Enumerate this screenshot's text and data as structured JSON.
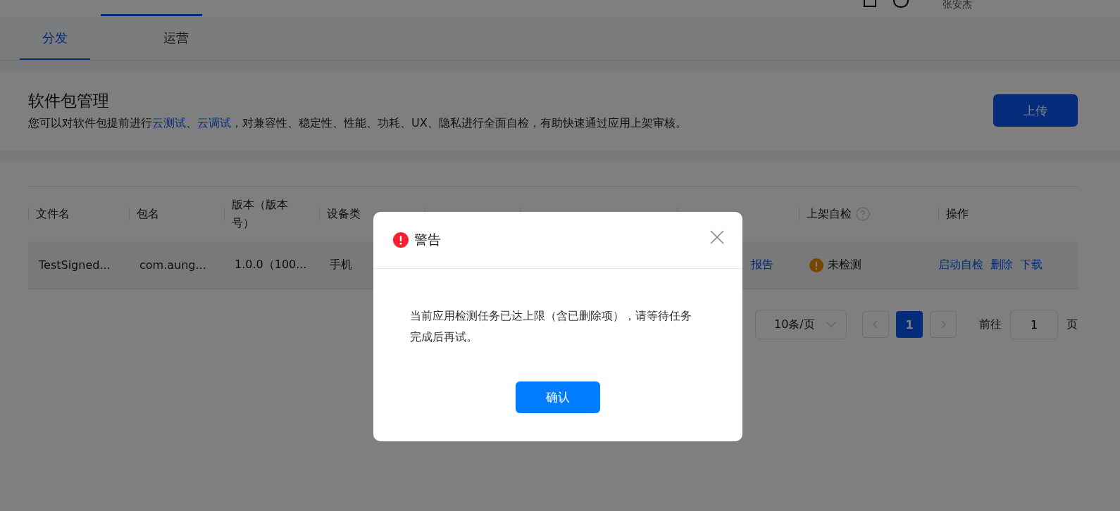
{
  "top_bar": {
    "user_name": "张安杰"
  },
  "tabs": [
    {
      "label": "分发",
      "selected": true
    },
    {
      "label": "运营",
      "selected": false
    }
  ],
  "header_card": {
    "title": "软件包管理",
    "description_parts": [
      {
        "text": "您可以对软件包提前进行",
        "link": false
      },
      {
        "text": "云测试",
        "link": true
      },
      {
        "text": "、",
        "link": false
      },
      {
        "text": "云调试",
        "link": true
      },
      {
        "text": "，对兼容性、稳定性、性能、功耗、UX、隐私进行全面自检，有助快速通过应用上架审核。",
        "link": false
      }
    ],
    "upload_button": "上传"
  },
  "table": {
    "columns": [
      {
        "label": "文件名",
        "help": false
      },
      {
        "label": "包名",
        "help": false
      },
      {
        "label": "版本（版本号）",
        "help": false
      },
      {
        "label": "设备类",
        "help": false
      },
      {
        "label": "上架自检",
        "help": true
      },
      {
        "label": "操作",
        "help": false
      }
    ],
    "rows": [
      {
        "file_name": "TestSigned...",
        "package": "com.aung...",
        "version": "1.0.0（100...",
        "device": "手机",
        "legality_link": "报告",
        "self_check": "未检测",
        "actions": [
          "启动自检",
          "删除",
          "下载"
        ]
      }
    ]
  },
  "pagination": {
    "page_size": "10条/页",
    "pages": [
      {
        "label": "1",
        "selected": true
      }
    ],
    "goto_label": "前往",
    "goto_value": "1",
    "page_unit": "页"
  },
  "dialog": {
    "title": "警告",
    "message": "当前应用检测任务已达上限（含已删除项），请等待任务完成后再试。",
    "confirm_button": "确认"
  }
}
